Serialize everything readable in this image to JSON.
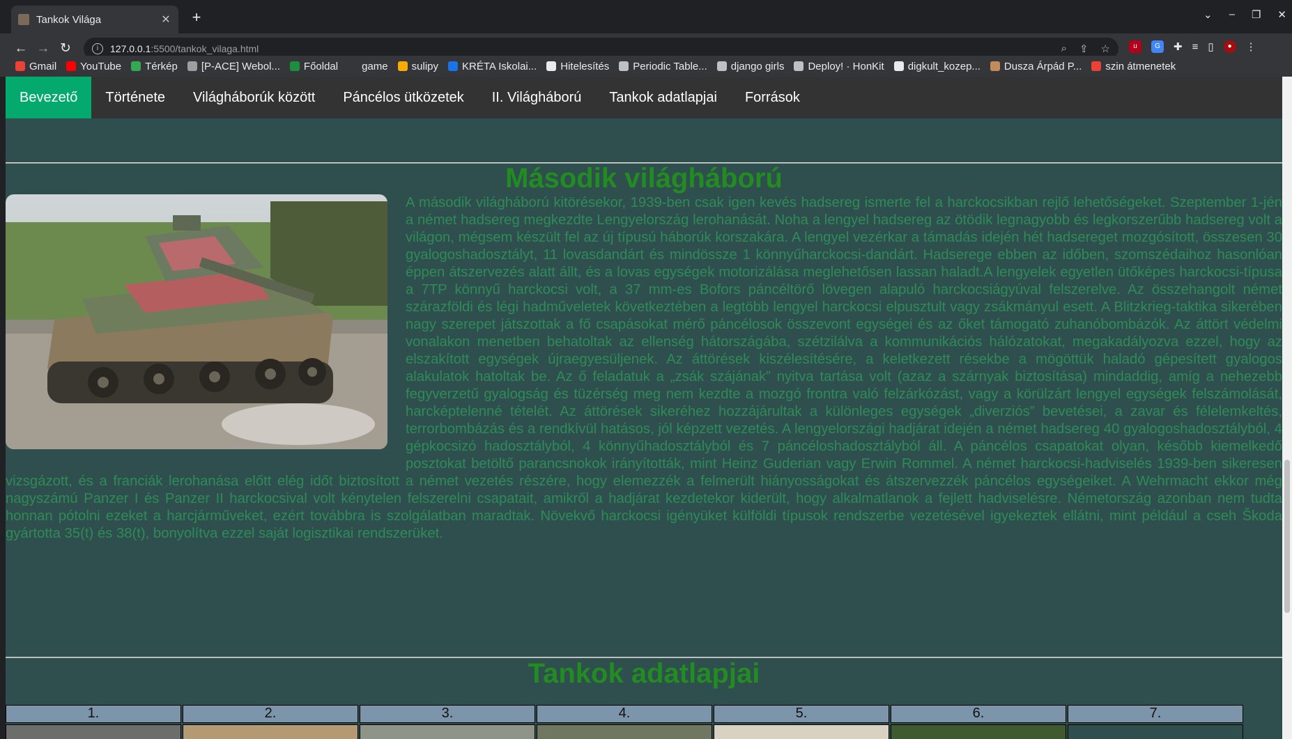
{
  "browser": {
    "tab_title": "Tankok Világa",
    "url_host": "127.0.0.1",
    "url_path": ":5500/tankok_vilaga.html",
    "bookmarks": [
      {
        "label": "Gmail",
        "color": "#ea4335"
      },
      {
        "label": "YouTube",
        "color": "#ff0000"
      },
      {
        "label": "Térkép",
        "color": "#34a853"
      },
      {
        "label": "[P-ACE] Webol...",
        "color": "#9e9e9e"
      },
      {
        "label": "Főoldal",
        "color": "#1e8e3e"
      },
      {
        "label": "game",
        "color": "#35363a"
      },
      {
        "label": "sulipy",
        "color": "#f9ab00"
      },
      {
        "label": "KRÉTA Iskolai...",
        "color": "#1a73e8"
      },
      {
        "label": "Hitelesítés",
        "color": "#e8eaed"
      },
      {
        "label": "Periodic Table...",
        "color": "#bdc1c6"
      },
      {
        "label": "django girls",
        "color": "#bdc1c6"
      },
      {
        "label": "Deploy! · HonKit",
        "color": "#bdc1c6"
      },
      {
        "label": "digkult_kozep...",
        "color": "#e8eaed"
      },
      {
        "label": "Dusza Árpád P...",
        "color": "#c28b5a"
      },
      {
        "label": "szin átmenetek",
        "color": "#ea4335"
      }
    ]
  },
  "nav": {
    "items": [
      "Bevezető",
      "Története",
      "Világháborúk között",
      "Páncélos ütközetek",
      "II. Világháború",
      "Tankok adatlapjai",
      "Források"
    ],
    "active_color": "#04aa6d"
  },
  "section_ww2": {
    "title": "Második világháború",
    "text": "A második világháború kitörésekor, 1939-ben csak igen kevés hadsereg ismerte fel a harckocsikban rejlő lehetőségeket. Szeptember 1-jén a német hadsereg megkezdte Lengyelország lerohanását. Noha a lengyel hadsereg az ötödik legnagyobb és legkorszerűbb hadsereg volt a világon, mégsem készült fel az új típusú háborúk korszakára. A lengyel vezérkar a támadás idején hét hadsereget mozgósított, összesen 30 gyalogoshadosztályt, 11 lovasdandárt és mindössze 1 könnyűharckocsi-dandárt. Hadserege ebben az időben, szomszédaihoz hasonlóan éppen átszervezés alatt állt, és a lovas egységek motorizálása meglehetősen lassan haladt.A lengyelek egyetlen ütőképes harckocsi-típusa a 7TP könnyű harckocsi volt, a 37 mm-es Bofors páncéltörő lövegen alapuló harckocsiágyúval felszerelve. Az összehangolt német szárazföldi és légi hadműveletek következtében a legtöbb lengyel harckocsi elpusztult vagy zsákmányul esett. A Blitzkrieg-taktika sikerében nagy szerepet játszottak a fő csapásokat mérő páncélosok összevont egységei és az őket támogató zuhanóbombázók. Az áttört védelmi vonalakon menetben behatoltak az ellenség hátországába, szétzilálva a kommunikációs hálózatokat, megakadályozva ezzel, hogy az elszakított egységek újraegyesüljenek. Az áttörések kiszélesítésére, a keletkezett résekbe a mögöttük haladó gépesített gyalogos alakulatok hatoltak be. Az ő feladatuk a „zsák szájának” nyitva tartása volt (azaz a szárnyak biztosítása) mindaddig, amíg a nehezebb fegyverzetű gyalogság és tüzérség meg nem kezdte a mozgó frontra való felzárkózást, vagy a körülzárt lengyel egységek felszámolását, harcképtelenné tételét. Az áttörések sikeréhez hozzájárultak a különleges egységek „diverziós” bevetései, a zavar és félelemkeltés, terrorbombázás és a rendkívül hatásos, jól képzett vezetés. A lengyelországi hadjárat idején a német hadsereg 40 gyalogoshadosztályból, 4 gépkocsizó hadosztályból, 4 könnyűhadosztályból és 7 páncéloshadosztályból áll. A páncélos csapatokat olyan, később kiemelkedő posztokat betöltő parancsnokok irányították, mint Heinz Guderian vagy Erwin Rommel. A német harckocsi-hadviselés 1939-ben sikeresen vizsgázott, és a franciák lerohanása előtt elég időt biztosított a német vezetés részére, hogy elemezzék a felmerült hiányosságokat és átszervezzék páncélos egységeiket. A Wehrmacht ekkor még nagyszámú Panzer I és Panzer II harckocsival volt kénytelen felszerelni csapatait, amikről a hadjárat kezdetekor kiderült, hogy alkalmatlanok a fejlett hadviselésre. Németország azonban nem tudta honnan pótolni ezeket a harcjárműveket, ezért továbbra is szolgálatban maradtak. Növekvő harckocsi igényüket külföldi típusok rendszerbe vezetésével igyekeztek ellátni, mint például a cseh Škoda gyártotta 35(t) és 38(t), bonyolítva ezzel saját logisztikai rendszerüket."
  },
  "section_datasheets": {
    "title": "Tankok adatlapjai",
    "columns": [
      {
        "label": "1.",
        "color": "#6b6e6a"
      },
      {
        "label": "2.",
        "color": "#b49a72"
      },
      {
        "label": "3.",
        "color": "#8f9488"
      },
      {
        "label": "4.",
        "color": "#6f7760"
      },
      {
        "label": "5.",
        "color": "#d9d2c2"
      },
      {
        "label": "6.",
        "color": "#3f5a2f"
      },
      {
        "label": "7.",
        "color": "#2f4f4f"
      }
    ]
  }
}
